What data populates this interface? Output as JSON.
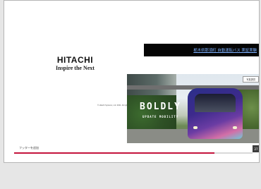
{
  "slide": {
    "title_link": "栃木県那須町 自動運転バス 実証実験",
    "logo_wordmark": "HITACHI",
    "logo_tagline": "Inspire the Next",
    "copyright": "© Hitachi Systems, Ltd. 2021. All rights reserved.",
    "photo": {
      "badge": "写真提供",
      "brand_text": "BOLDLY",
      "brand_subtext": "UPDATE MOBILITY"
    },
    "footer_label": "フッターを追加",
    "page_number": "27",
    "progress": 0.84
  },
  "colors": {
    "title_bar_bg": "#050505",
    "title_link": "#7fb2ff",
    "accent_progress": "#c4143c",
    "page_number_bg": "#3c3c3c"
  }
}
